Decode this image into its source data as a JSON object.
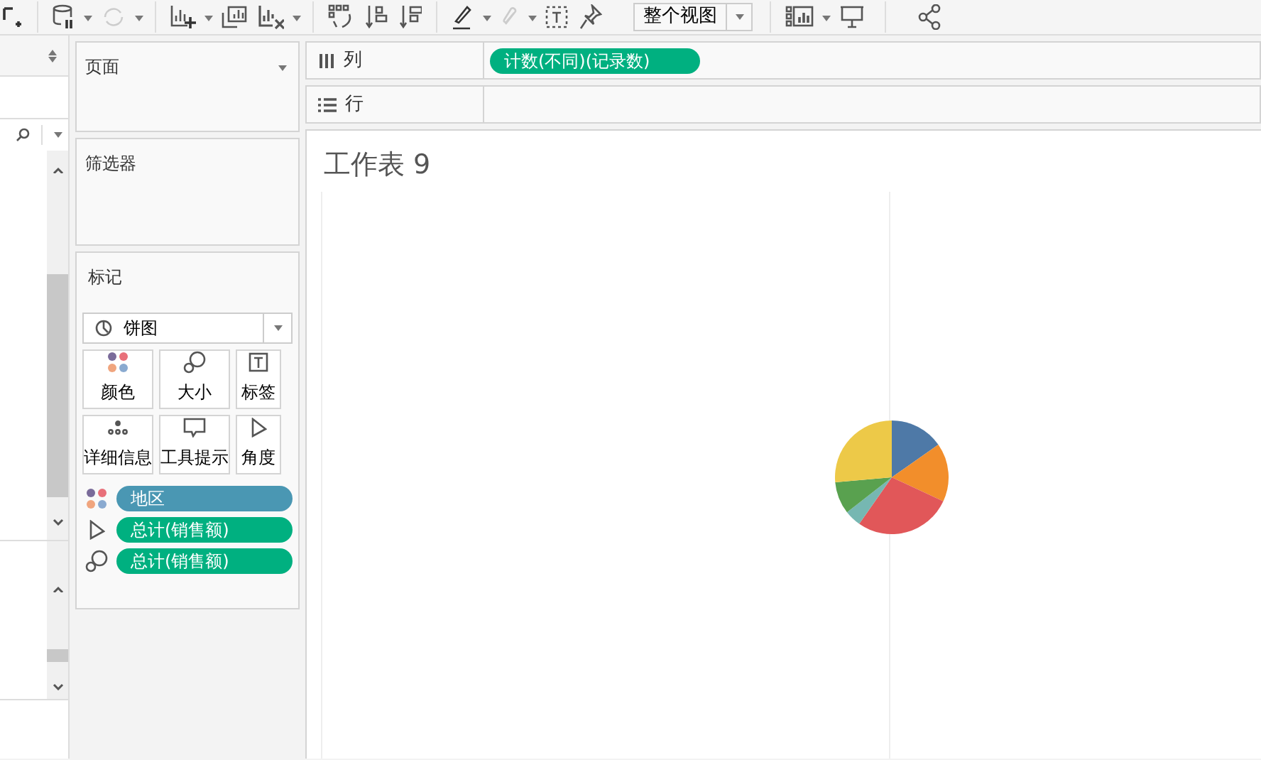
{
  "toolbar": {
    "fit_dropdown": "整个视图"
  },
  "pages_card": {
    "title": "页面"
  },
  "filters_card": {
    "title": "筛选器"
  },
  "marks_card": {
    "title": "标记",
    "mark_type": "饼图",
    "buttons": [
      {
        "kind": "color",
        "label": "颜色"
      },
      {
        "kind": "size",
        "label": "大小"
      },
      {
        "kind": "label",
        "label": "标签"
      },
      {
        "kind": "detail",
        "label": "详细信息"
      },
      {
        "kind": "tooltip",
        "label": "工具提示"
      },
      {
        "kind": "angle",
        "label": "角度"
      }
    ],
    "pills": [
      {
        "kind": "color",
        "label": "地区",
        "color": "#4a97b3"
      },
      {
        "kind": "angle",
        "label": "总计(销售额)",
        "color": "#00b080"
      },
      {
        "kind": "size",
        "label": "总计(销售额)",
        "color": "#00b080"
      }
    ]
  },
  "columns_shelf": {
    "label": "列",
    "pills": [
      {
        "label": "计数(不同)(记录数)"
      }
    ]
  },
  "rows_shelf": {
    "label": "行"
  },
  "sheet": {
    "title": "工作表 9"
  }
}
